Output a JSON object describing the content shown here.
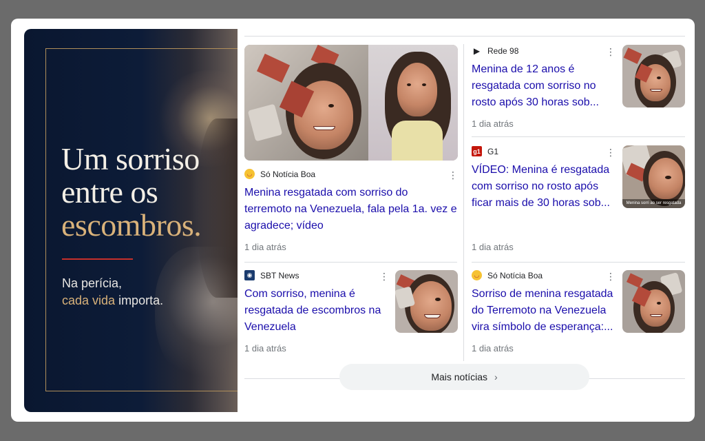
{
  "banner": {
    "headline_line1": "Um sorriso",
    "headline_line2": "entre os",
    "headline_line3": "escombros.",
    "tagline_line1": "Na perícia,",
    "tagline_gold": "cada vida",
    "tagline_rest": " importa."
  },
  "articles": [
    {
      "source": "Só Notícia Boa",
      "source_logo": "smiley-logo-icon",
      "title": "Menina resgatada com sorriso do terremoto na Venezuela, fala pela 1a. vez e agradece; vídeo",
      "time": "1 dia atrás"
    },
    {
      "source": "Rede 98",
      "source_logo": "play-logo-icon",
      "title": "Menina de 12 anos é resgatada com sorriso no rosto após 30 horas sob...",
      "time": "1 dia atrás"
    },
    {
      "source": "G1",
      "source_logo": "g1-logo-icon",
      "logo_text": "g1",
      "title": "VÍDEO: Menina é resgatada com sorriso no rosto após ficar mais de 30 horas sob...",
      "time": "1 dia atrás",
      "thumb_caption": "Menina sorri ao ser resgatada"
    },
    {
      "source": "SBT News",
      "source_logo": "sbt-logo-icon",
      "title": "Com sorriso, menina é resgatada de escombros na Venezuela",
      "time": "1 dia atrás"
    },
    {
      "source": "Só Notícia Boa",
      "source_logo": "smiley-logo-icon",
      "title": "Sorriso de menina resgatada do Terremoto na Venezuela vira símbolo de esperança:...",
      "time": "1 dia atrás"
    }
  ],
  "more_button": {
    "label": "Mais notícias",
    "icon": "chevron-right-icon"
  },
  "colors": {
    "link": "#1a0dab",
    "banner_bg": "#0d1c38",
    "gold": "#d9b27a",
    "accent_red": "#c8302b"
  }
}
